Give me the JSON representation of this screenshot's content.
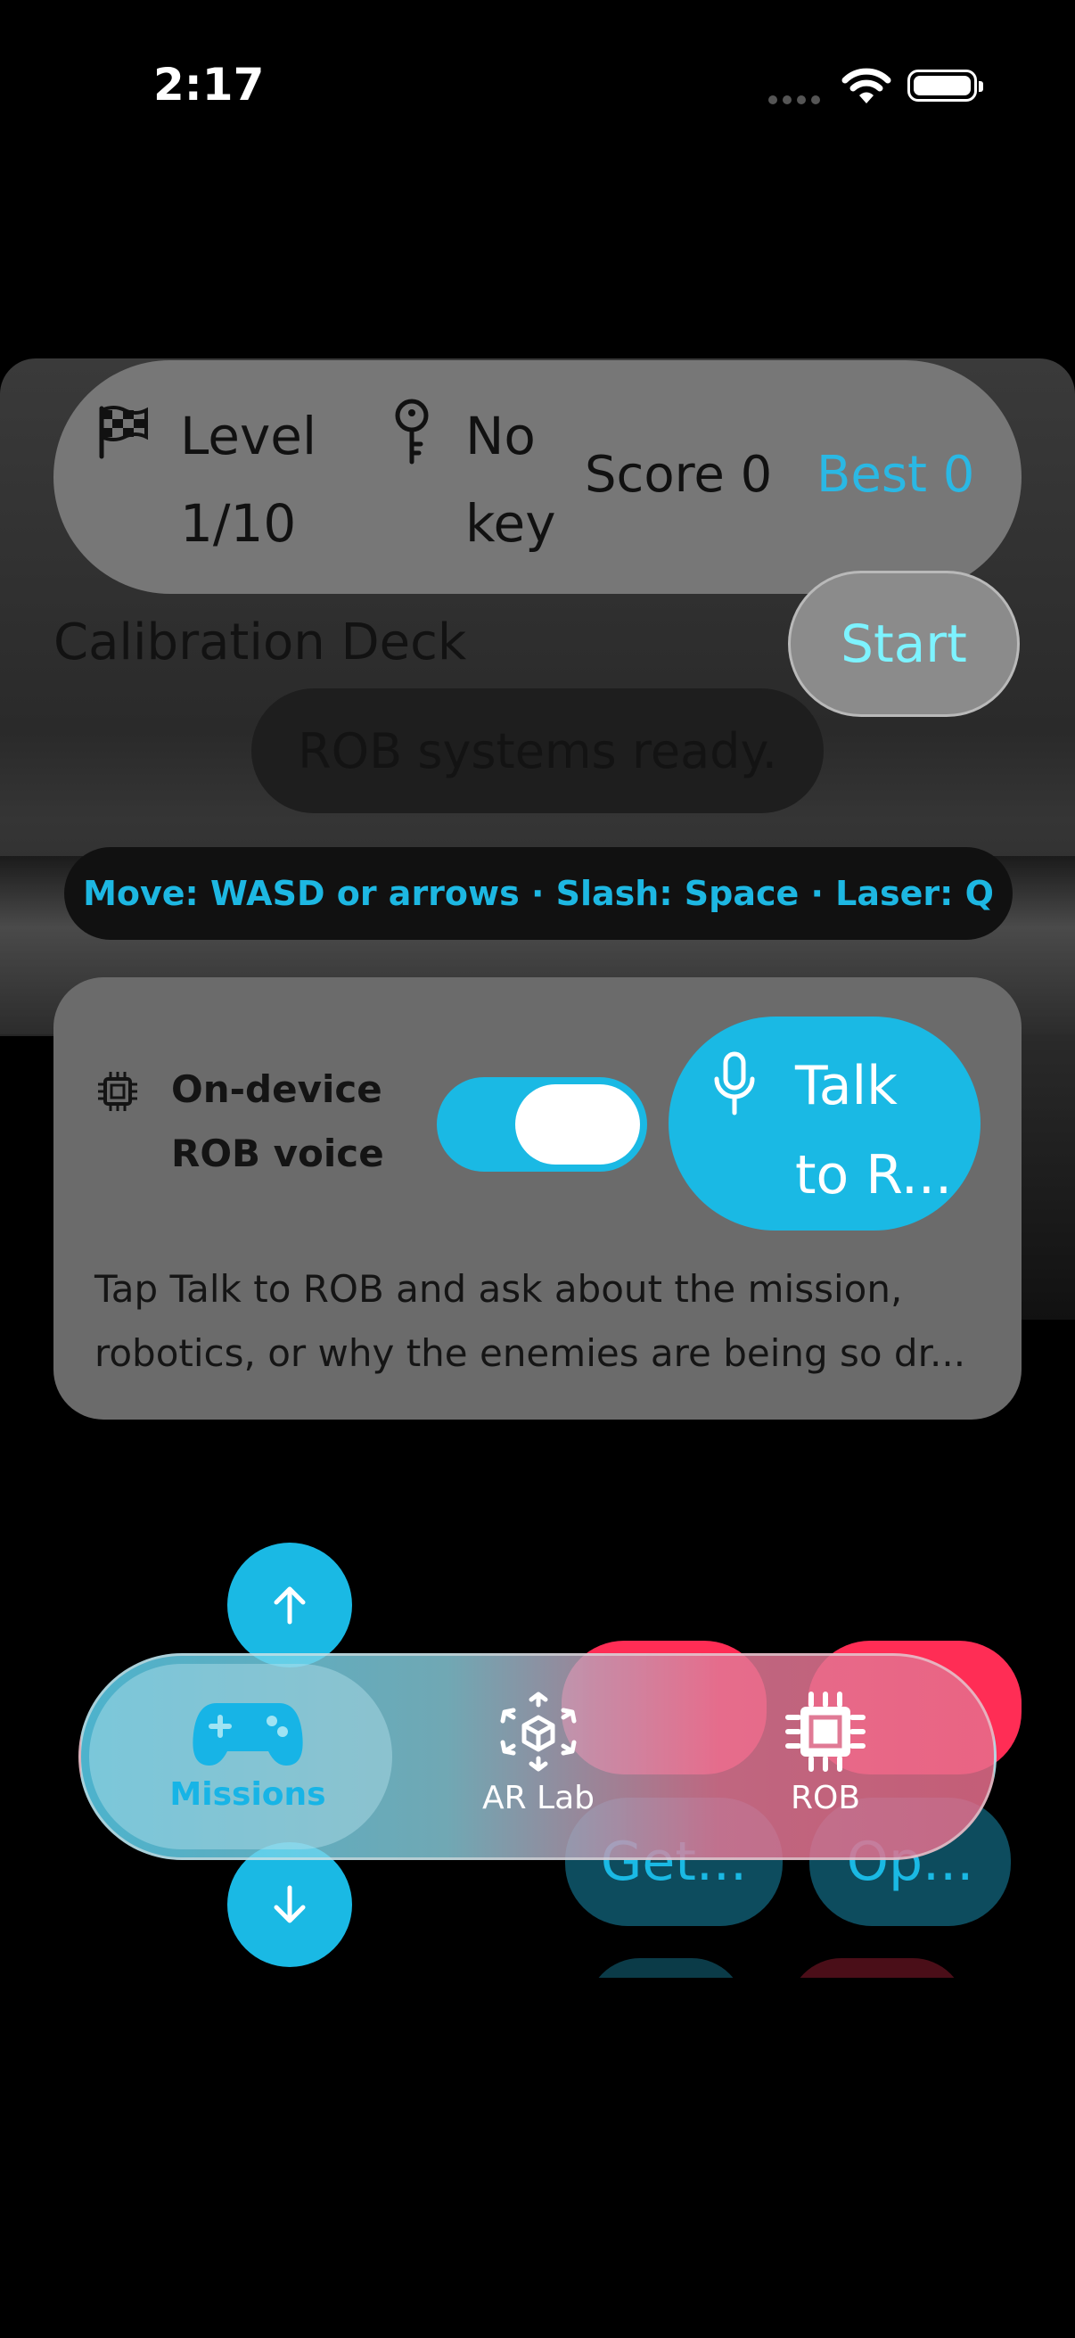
{
  "status_bar": {
    "time": "2:17"
  },
  "hud": {
    "level_label": "Level",
    "level_value": "1/10",
    "key_label": "No",
    "key_value": "key",
    "score": "Score 0",
    "best": "Best 0"
  },
  "deck": {
    "title": "Calibration Deck",
    "start_label": "Start",
    "status_message": "ROB systems ready.",
    "controls_hint": "Move: WASD or arrows · Slash: Space · Laser: Q"
  },
  "voice": {
    "label_line1": "On-device",
    "label_line2": "ROB voice",
    "toggle_on": true,
    "talk_line1": "Talk",
    "talk_line2": "to R...",
    "description_line1": "Tap Talk to ROB and ask about the mission,",
    "description_line2": "robotics, or why the enemies are being so dr..."
  },
  "actions": {
    "button3_label": "Get...",
    "button4_label": "Op..."
  },
  "tabbar": {
    "tabs": [
      {
        "label": "Missions",
        "icon": "gamepad-icon",
        "selected": true
      },
      {
        "label": "AR Lab",
        "icon": "ar-cube-icon",
        "selected": false
      },
      {
        "label": "ROB",
        "icon": "chip-icon",
        "selected": false
      }
    ]
  },
  "colors": {
    "accent": "#1ab9e4",
    "danger": "#ff2d55",
    "start_text": "#7df3ff"
  }
}
